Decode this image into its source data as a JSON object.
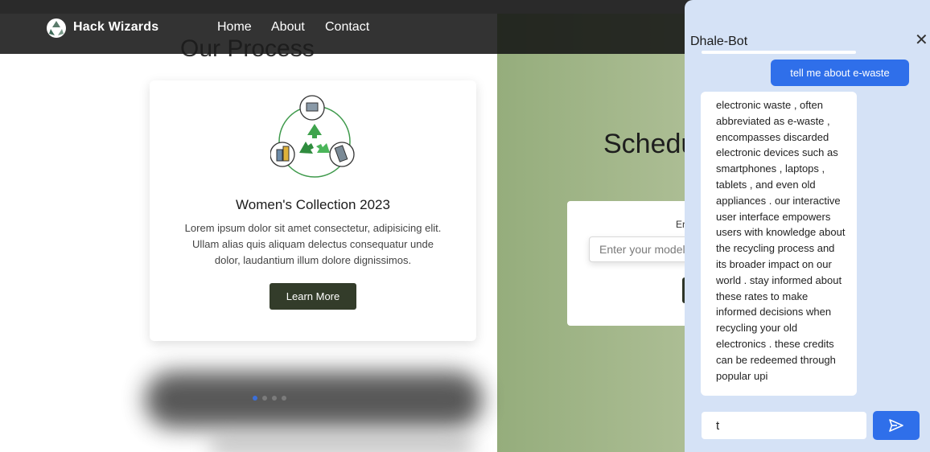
{
  "header": {
    "brand": "Hack Wizards",
    "nav": [
      "Home",
      "About",
      "Contact"
    ]
  },
  "process": {
    "heading": "Our Process",
    "card": {
      "title": "Women's Collection 2023",
      "text": "Lorem ipsum dolor sit amet consectetur, adipisicing elit. Ullam alias quis aliquam delectus consequatur unde dolor, laudantium illum dolore dignissimos.",
      "button_label": "Learn More"
    }
  },
  "schedule": {
    "title": "Schedu",
    "field_label": "Er",
    "input_placeholder": "Enter your model"
  },
  "chat": {
    "title": "Dhale-Bot",
    "close_icon": "close-icon",
    "user_message": "tell me about e-waste",
    "bot_message": "electronic waste , often abbreviated as e-waste , encompasses discarded electronic devices such as smartphones , laptops , tablets , and even old appliances . our interactive user interface empowers users with knowledge about the recycling process and its broader impact on our world . stay informed about these rates to make informed decisions when recycling your old electronics . these credits can be redeemed through popular upi",
    "input_value": "t",
    "send_icon": "send-icon"
  },
  "colors": {
    "header_bg": "#121212",
    "accent_blue": "#2f6fea",
    "button_dark": "#333c2a",
    "green_section": "#adbe95",
    "chat_panel_bg": "#d5e2f6"
  }
}
